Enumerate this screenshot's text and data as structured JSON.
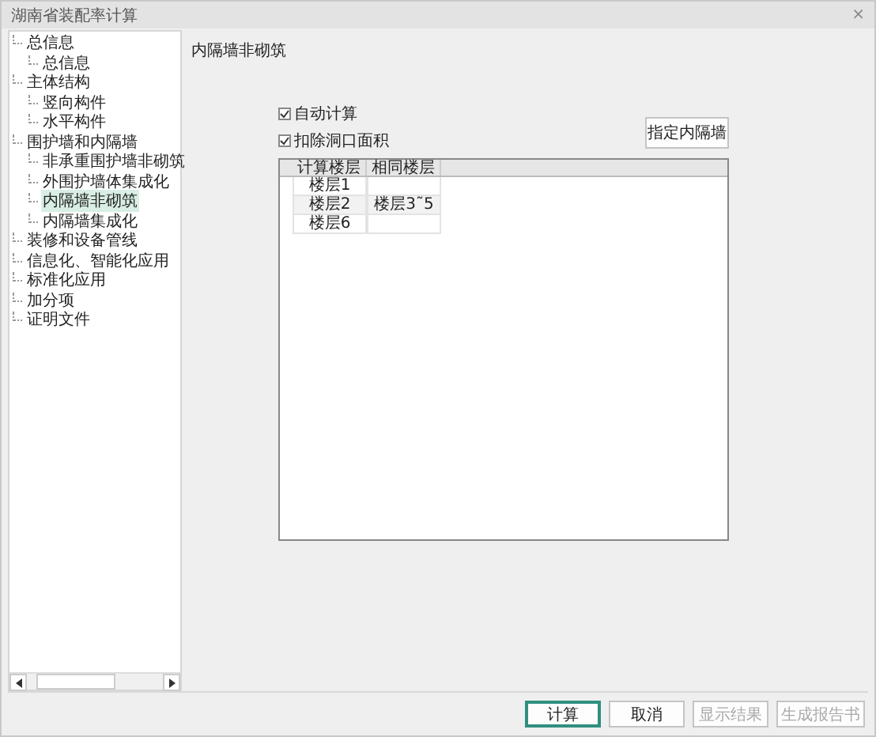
{
  "window": {
    "title": "湖南省装配率计算",
    "close": "×"
  },
  "tree": [
    {
      "label": "总信息",
      "selected": false,
      "children": [
        {
          "label": "总信息",
          "selected": false
        }
      ]
    },
    {
      "label": "主体结构",
      "selected": false,
      "children": [
        {
          "label": "竖向构件",
          "selected": false
        },
        {
          "label": "水平构件",
          "selected": false
        }
      ]
    },
    {
      "label": "围护墙和内隔墙",
      "selected": false,
      "children": [
        {
          "label": "非承重围护墙非砌筑",
          "selected": false
        },
        {
          "label": "外围护墙体集成化",
          "selected": false
        },
        {
          "label": "内隔墙非砌筑",
          "selected": true
        },
        {
          "label": "内隔墙集成化",
          "selected": false
        }
      ]
    },
    {
      "label": "装修和设备管线",
      "selected": false
    },
    {
      "label": "信息化、智能化应用",
      "selected": false
    },
    {
      "label": "标准化应用",
      "selected": false
    },
    {
      "label": "加分项",
      "selected": false
    },
    {
      "label": "证明文件",
      "selected": false
    }
  ],
  "panel": {
    "heading": "内隔墙非砌筑",
    "options": [
      {
        "label": "自动计算",
        "checked": true
      },
      {
        "label": "扣除洞口面积",
        "checked": true
      }
    ],
    "assign_button": "指定内隔墙",
    "table": {
      "columns": [
        "计算楼层",
        "相同楼层"
      ],
      "rows": [
        {
          "cells": [
            "楼层1",
            ""
          ],
          "selected": false
        },
        {
          "cells": [
            "楼层2",
            "楼层3˜5"
          ],
          "selected": true
        },
        {
          "cells": [
            "楼层6",
            ""
          ],
          "selected": false
        }
      ]
    }
  },
  "buttons": [
    {
      "label": "计算",
      "default": true,
      "disabled": false
    },
    {
      "label": "取消",
      "default": false,
      "disabled": false
    },
    {
      "label": "显示结果",
      "default": false,
      "disabled": true
    },
    {
      "label": "生成报告书",
      "default": false,
      "disabled": true
    }
  ]
}
